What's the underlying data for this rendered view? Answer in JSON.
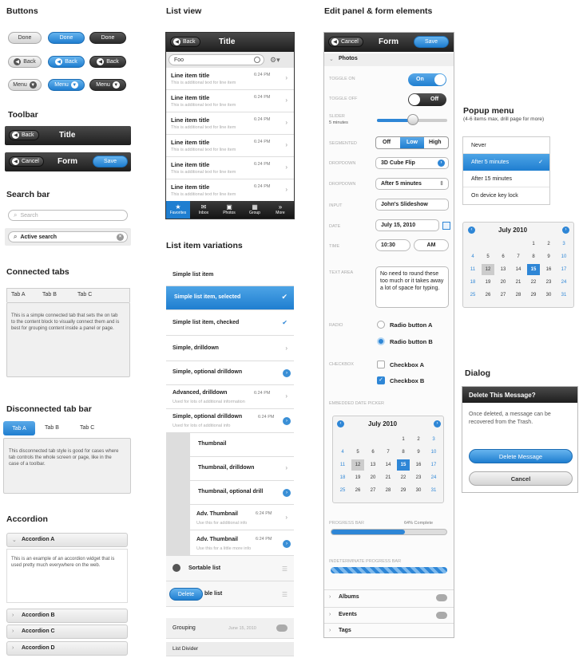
{
  "col1": {
    "buttons": {
      "heading": "Buttons",
      "done": "Done",
      "back": "Back",
      "menu": "Menu"
    },
    "toolbar": {
      "heading": "Toolbar",
      "back": "Back",
      "title": "Title",
      "cancel": "Cancel",
      "form": "Form",
      "save": "Save"
    },
    "search": {
      "heading": "Search bar",
      "placeholder": "Search",
      "active": "Active search"
    },
    "connected": {
      "heading": "Connected tabs",
      "tabs": [
        "Tab A",
        "Tab B",
        "Tab C"
      ],
      "text": "This is a simple connected tab that sets the on tab to the content block to visually connect them and is best for grouping content inside a panel or page."
    },
    "disconnected": {
      "heading": "Disconnected tab bar",
      "tabs": [
        "Tab A",
        "Tab B",
        "Tab C"
      ],
      "text": "This disconnected tab style is good for cases where tab controls the whole screen or page, like in the case of a toolbar."
    },
    "accordion": {
      "heading": "Accordion",
      "open": "Accordion A",
      "text": "This is an example of an accordion widget that is used pretty much everywhere on the web.",
      "closed": [
        "Accordion B",
        "Accordion C",
        "Accordion D"
      ]
    }
  },
  "col2": {
    "heading": "List view",
    "bar": {
      "back": "Back",
      "title": "Title"
    },
    "search": "Foo",
    "items": [
      {
        "title": "Line item title",
        "time": "6:24 PM",
        "sub": "This is additional text for line item"
      },
      {
        "title": "Line item title",
        "time": "6:24 PM",
        "sub": "This is additional text for line item"
      },
      {
        "title": "Line item title",
        "time": "6:24 PM",
        "sub": "This is additional text for line item"
      },
      {
        "title": "Line item title",
        "time": "6:24 PM",
        "sub": "This is additional text for line item"
      },
      {
        "title": "Line item title",
        "time": "6:24 PM",
        "sub": "This is additional text for line item"
      },
      {
        "title": "Line item title",
        "time": "6:24 PM",
        "sub": "This is additional text for line item"
      }
    ],
    "tabs": [
      "Favorites",
      "Inbox",
      "Photos",
      "Group",
      "More"
    ],
    "var_heading": "List item variations",
    "variations": {
      "simple": "Simple list item",
      "selected": "Simple list item, selected",
      "checked": "Simple list item, checked",
      "drilldown": "Simple, drilldown",
      "optional": "Simple, optional drilldown",
      "adv": "Advanced, drilldown",
      "adv_time": "6:24 PM",
      "adv_sub": "Used for lots of additional information",
      "simple_opt2": "Simple, optional drilldown",
      "simple_opt2_time": "6:24 PM",
      "simple_opt2_sub": "Used for lots of additional info",
      "thumb": "Thumbnail",
      "thumb_drill": "Thumbnail, drilldown",
      "thumb_opt": "Thumbnail, optional drill",
      "advthumb": "Adv. Thumbnail",
      "advthumb_time": "6:24 PM",
      "advthumb_sub": "Use this for additional info",
      "advthumb2": "Adv. Thumbnail",
      "advthumb2_time": "6:24 PM",
      "advthumb2_sub": "Use this for a little more info",
      "sortable": "Sortable list",
      "delete": "Delete",
      "deletable": "ble list",
      "grouping": "Grouping",
      "grouping_date": "June 15, 2010",
      "divider": "List Divider"
    }
  },
  "col3": {
    "heading": "Edit panel & form elements",
    "bar": {
      "cancel": "Cancel",
      "title": "Form",
      "save": "Save"
    },
    "photos": "Photos",
    "labels": [
      "Toggle on",
      "Toggle off",
      "Slider",
      "Segmented",
      "Dropdown",
      "Dropdown",
      "Input",
      "Date",
      "Time",
      "Text area",
      "Radio",
      "Checkbox"
    ],
    "slider_label": "Slider",
    "slider_value": "5 minutes",
    "toggle_on": "On",
    "toggle_off": "Off",
    "segments": [
      "Off",
      "Low",
      "High"
    ],
    "dropdown1": "3D Cube Flip",
    "dropdown2": "After 5 minutes",
    "input": "John's Slideshow",
    "date": "July 15, 2010",
    "time": "10:30",
    "ampm": "AM",
    "textarea": "No need to round these too much or it takes away a lot of space for typing.",
    "radios": [
      "Radio button A",
      "Radio button B"
    ],
    "checks": [
      "Checkbox A",
      "Checkbox B"
    ],
    "inline_cal": "Embedded date picker",
    "cal_month": "July 2010",
    "cal_rows": [
      [
        "",
        "",
        "",
        "",
        "1",
        "2",
        "3"
      ],
      [
        "4",
        "5",
        "6",
        "7",
        "8",
        "9",
        "10"
      ],
      [
        "11",
        "12",
        "13",
        "14",
        "15",
        "16",
        "17"
      ],
      [
        "18",
        "19",
        "20",
        "21",
        "22",
        "23",
        "24"
      ],
      [
        "25",
        "26",
        "27",
        "28",
        "29",
        "30",
        "31"
      ]
    ],
    "progress_label": "Progress bar",
    "progress_value": "64% Complete",
    "progress": 0.64,
    "indet_label": "Indeterminate progress bar",
    "sections": [
      "Albums",
      "Events",
      "Tags"
    ]
  },
  "col4": {
    "popup_heading": "Popup menu",
    "popup_sub": "(4-6 items max, drill page for more)",
    "popup_items": [
      "Never",
      "After 5 minutes",
      "After 15 minutes",
      "On device key lock"
    ],
    "cal_month": "July 2010",
    "cal_rows": [
      [
        "",
        "",
        "",
        "",
        "1",
        "2",
        "3"
      ],
      [
        "4",
        "5",
        "6",
        "7",
        "8",
        "9",
        "10"
      ],
      [
        "11",
        "12",
        "13",
        "14",
        "15",
        "16",
        "17"
      ],
      [
        "18",
        "19",
        "20",
        "21",
        "22",
        "23",
        "24"
      ],
      [
        "25",
        "26",
        "27",
        "28",
        "29",
        "30",
        "31"
      ]
    ],
    "dialog_heading": "Dialog",
    "dialog_title": "Delete This Message?",
    "dialog_text": "Once deleted, a message can be recovered from the Trash.",
    "dialog_delete": "Delete Message",
    "dialog_cancel": "Cancel"
  },
  "colors": {
    "accent": "#2e86d6",
    "dark": "#2b2b2b",
    "bg": "#f0f0f0"
  }
}
